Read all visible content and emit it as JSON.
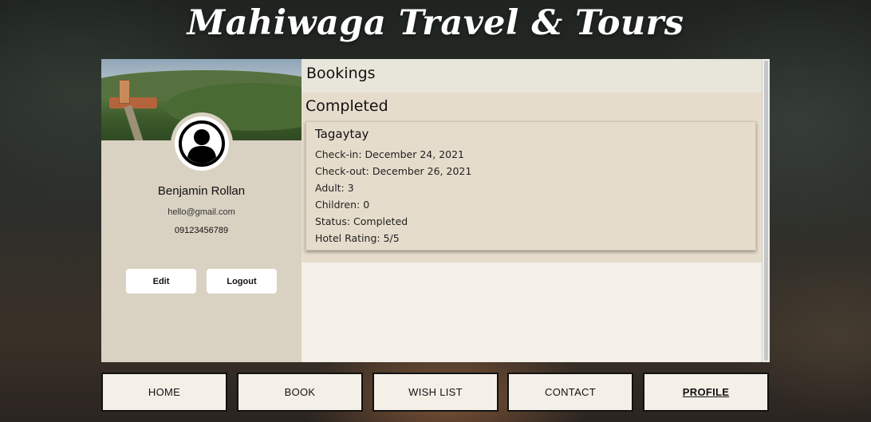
{
  "site": {
    "title": "Mahiwaga Travel & Tours"
  },
  "profile": {
    "name": "Benjamin Rollan",
    "email": "hello@gmail.com",
    "phone": "09123456789",
    "edit_label": "Edit",
    "logout_label": "Logout",
    "avatar_icon": "user-avatar-icon"
  },
  "bookings": {
    "header": "Bookings",
    "section_title": "Completed",
    "items": [
      {
        "destination": "Tagaytay",
        "check_in": "Check-in: December 24, 2021",
        "check_out": "Check-out: December 26, 2021",
        "adult": "Adult: 3",
        "children": "Children: 0",
        "status": "Status: Completed",
        "rating": "Hotel Rating: 5/5"
      }
    ]
  },
  "nav": {
    "items": [
      {
        "label": "HOME",
        "active": false
      },
      {
        "label": "BOOK",
        "active": false
      },
      {
        "label": "WISH LIST",
        "active": false
      },
      {
        "label": "CONTACT",
        "active": false
      },
      {
        "label": "PROFILE",
        "active": true
      }
    ]
  },
  "colors": {
    "panel_bg": "#f4f0e8",
    "profile_bg": "#d9d2c2",
    "section_bg": "#e6dccb",
    "header_bg": "#e8e6da"
  }
}
